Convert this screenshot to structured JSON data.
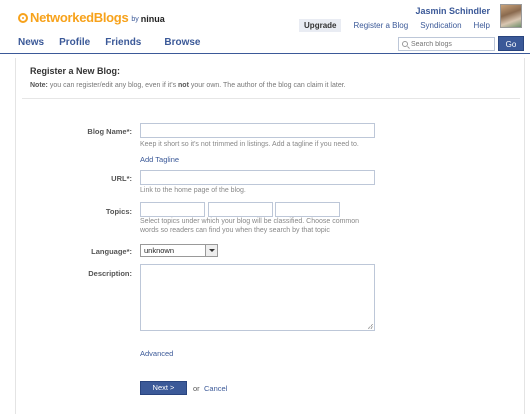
{
  "header": {
    "logo_text": "NetworkedBlogs",
    "logo_by": "by",
    "logo_ninua": "ninua",
    "user_name": "Jasmin Schindler",
    "links": [
      "Upgrade",
      "Register a Blog",
      "Syndication",
      "Help"
    ]
  },
  "nav": {
    "items": [
      "News",
      "Profile",
      "Friends",
      "Browse"
    ],
    "search_placeholder": "Search blogs",
    "go_label": "Go"
  },
  "form": {
    "title": "Register a New Blog:",
    "note_label": "Note:",
    "note_part1": " you can register/edit any blog, even if it's ",
    "note_bold": "not",
    "note_part2": " your own. The author of the blog can claim it later.",
    "blog_name_label": "Blog Name*:",
    "blog_name_hint": "Keep it short so it's not trimmed in listings. Add a tagline if you need to.",
    "add_tagline": "Add Tagline",
    "url_label": "URL*:",
    "url_hint": "Link to the home page of the blog.",
    "topics_label": "Topics:",
    "topics_hint_line1": "Select topics under which your blog will be classified. Choose common",
    "topics_hint_line2": "words so readers can find you when they search by that topic",
    "language_label": "Language*:",
    "language_value": "unknown",
    "description_label": "Description:",
    "advanced": "Advanced",
    "next_label": "Next >",
    "or_text": "or",
    "cancel_label": "Cancel"
  },
  "colors": {
    "brand_blue": "#3b5998",
    "logo_orange": "#f7a21b"
  }
}
